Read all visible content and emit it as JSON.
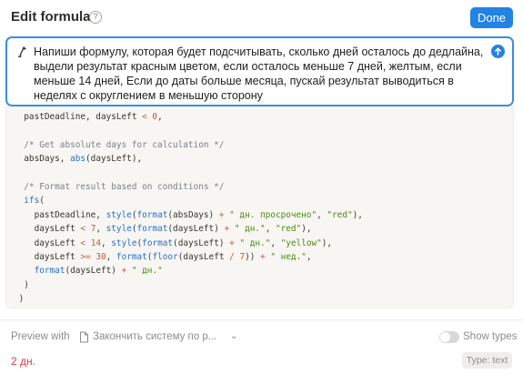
{
  "header": {
    "title": "Edit formula",
    "help_icon": "question-circle-icon",
    "done_label": "Done"
  },
  "prompt": {
    "icon": "ai-sparkle-icon",
    "text": "Напиши формулу, которая будет подсчитывать, сколько дней осталось до дедлайна, выдели результат красным цветом, если осталось меньше 7 дней, желтым, если меньше 14 дней, Если до даты больше месяца, пускай результат выводиться в неделях с округлением в меньшую сторону",
    "send_icon": "arrow-up-icon"
  },
  "code": {
    "lines": [
      [
        {
          "t": "  pastDeadline, daysLeft "
        },
        {
          "t": "<",
          "c": "op"
        },
        {
          "t": " "
        },
        {
          "t": "0",
          "c": "num"
        },
        {
          "t": ","
        }
      ],
      [
        {
          "t": ""
        }
      ],
      [
        {
          "t": "  "
        },
        {
          "t": "/* Get absolute days for calculation */",
          "c": "cm"
        }
      ],
      [
        {
          "t": "  absDays, "
        },
        {
          "t": "abs",
          "c": "kw"
        },
        {
          "t": "(daysLeft),"
        }
      ],
      [
        {
          "t": ""
        }
      ],
      [
        {
          "t": "  "
        },
        {
          "t": "/* Format result based on conditions */",
          "c": "cm"
        }
      ],
      [
        {
          "t": "  "
        },
        {
          "t": "ifs",
          "c": "kw"
        },
        {
          "t": "("
        }
      ],
      [
        {
          "t": "    pastDeadline, "
        },
        {
          "t": "style",
          "c": "kw"
        },
        {
          "t": "("
        },
        {
          "t": "format",
          "c": "kw"
        },
        {
          "t": "(absDays) "
        },
        {
          "t": "+",
          "c": "op"
        },
        {
          "t": " "
        },
        {
          "t": "\" дн. просрочено\"",
          "c": "str"
        },
        {
          "t": ", "
        },
        {
          "t": "\"red\"",
          "c": "str"
        },
        {
          "t": "),"
        }
      ],
      [
        {
          "t": "    daysLeft "
        },
        {
          "t": "<",
          "c": "op"
        },
        {
          "t": " "
        },
        {
          "t": "7",
          "c": "num"
        },
        {
          "t": ", "
        },
        {
          "t": "style",
          "c": "kw"
        },
        {
          "t": "("
        },
        {
          "t": "format",
          "c": "kw"
        },
        {
          "t": "(daysLeft) "
        },
        {
          "t": "+",
          "c": "op"
        },
        {
          "t": " "
        },
        {
          "t": "\" дн.\"",
          "c": "str"
        },
        {
          "t": ", "
        },
        {
          "t": "\"red\"",
          "c": "str"
        },
        {
          "t": "),"
        }
      ],
      [
        {
          "t": "    daysLeft "
        },
        {
          "t": "<",
          "c": "op"
        },
        {
          "t": " "
        },
        {
          "t": "14",
          "c": "num"
        },
        {
          "t": ", "
        },
        {
          "t": "style",
          "c": "kw"
        },
        {
          "t": "("
        },
        {
          "t": "format",
          "c": "kw"
        },
        {
          "t": "(daysLeft) "
        },
        {
          "t": "+",
          "c": "op"
        },
        {
          "t": " "
        },
        {
          "t": "\" дн.\"",
          "c": "str"
        },
        {
          "t": ", "
        },
        {
          "t": "\"yellow\"",
          "c": "str"
        },
        {
          "t": "),"
        }
      ],
      [
        {
          "t": "    daysLeft "
        },
        {
          "t": ">=",
          "c": "op"
        },
        {
          "t": " "
        },
        {
          "t": "30",
          "c": "num"
        },
        {
          "t": ", "
        },
        {
          "t": "format",
          "c": "kw"
        },
        {
          "t": "("
        },
        {
          "t": "floor",
          "c": "kw"
        },
        {
          "t": "(daysLeft "
        },
        {
          "t": "/",
          "c": "op"
        },
        {
          "t": " "
        },
        {
          "t": "7",
          "c": "num"
        },
        {
          "t": ")) "
        },
        {
          "t": "+",
          "c": "op"
        },
        {
          "t": " "
        },
        {
          "t": "\" нед.\"",
          "c": "str"
        },
        {
          "t": ","
        }
      ],
      [
        {
          "t": "    "
        },
        {
          "t": "format",
          "c": "kw"
        },
        {
          "t": "(daysLeft) "
        },
        {
          "t": "+",
          "c": "op"
        },
        {
          "t": " "
        },
        {
          "t": "\" дн.\"",
          "c": "str"
        }
      ],
      [
        {
          "t": "  )"
        }
      ],
      [
        {
          "t": " )"
        }
      ],
      [
        {
          "t": ")"
        }
      ]
    ]
  },
  "preview": {
    "label": "Preview with",
    "source_icon": "document-icon",
    "source": "Закончить систему по р...",
    "chevron_icon": "chevron-down-icon",
    "show_types_label": "Show types",
    "show_types_enabled": false,
    "result": "2 дн.",
    "type_badge": "Type: text"
  },
  "colors": {
    "accent": "#2383e2",
    "result": "#e03e3e"
  }
}
